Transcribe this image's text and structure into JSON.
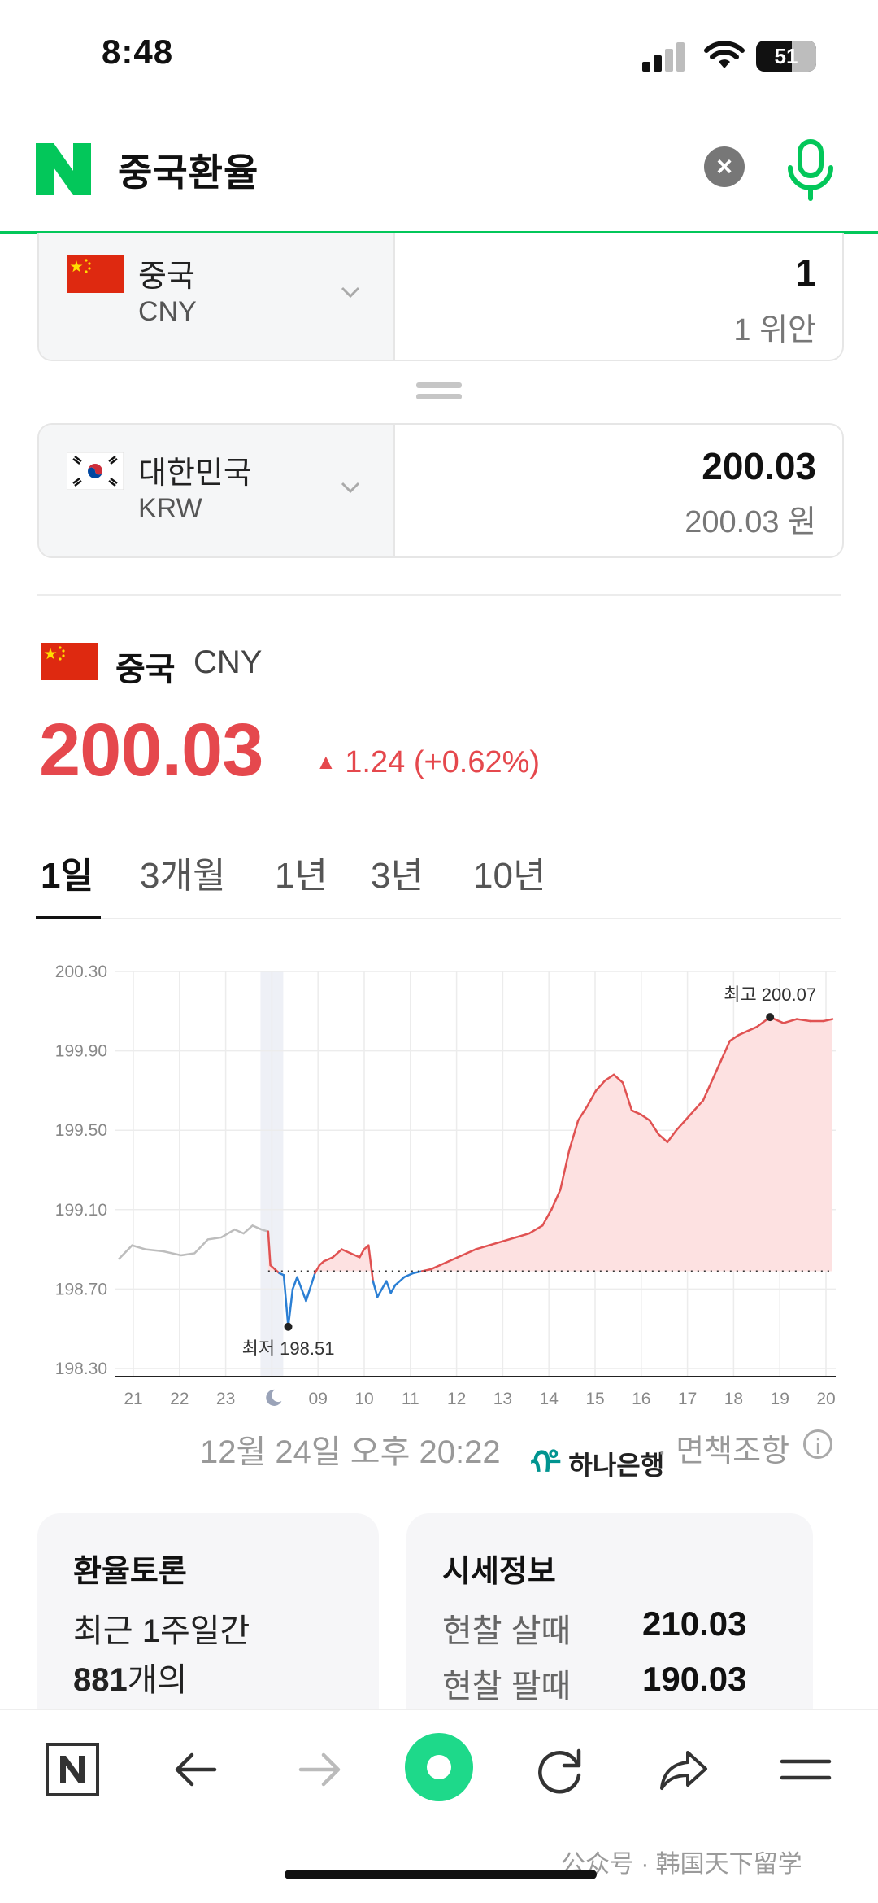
{
  "status_bar": {
    "time": "8:48",
    "battery": "51"
  },
  "search": {
    "query": "중국환율"
  },
  "converter": {
    "from": {
      "name": "중국",
      "code": "CNY",
      "amount": "1",
      "amount_text": "1 위안"
    },
    "to": {
      "name": "대한민국",
      "code": "KRW",
      "amount": "200.03",
      "amount_text": "200.03 원"
    }
  },
  "rate": {
    "country": "중국",
    "code": "CNY",
    "value": "200.03",
    "change": "1.24 (+0.62%)",
    "direction": "up",
    "color": "#e5484d"
  },
  "tabs": [
    {
      "label": "1일",
      "active": true
    },
    {
      "label": "3개월",
      "active": false
    },
    {
      "label": "1년",
      "active": false
    },
    {
      "label": "3년",
      "active": false
    },
    {
      "label": "10년",
      "active": false
    }
  ],
  "chart_data": {
    "type": "line",
    "y_ticks": [
      "200.30",
      "199.90",
      "199.50",
      "199.10",
      "198.70",
      "198.30"
    ],
    "ylim": [
      198.3,
      200.3
    ],
    "x_ticks": [
      "21",
      "22",
      "23",
      "moon-icon",
      "09",
      "10",
      "11",
      "12",
      "13",
      "14",
      "15",
      "16",
      "17",
      "18",
      "19",
      "20"
    ],
    "baseline": 198.79,
    "max_label": "최고 200.07",
    "min_label": "최저 198.51",
    "colors": {
      "up": "#e05252",
      "down": "#2b7fd4",
      "prior": "#bdbdbd",
      "fill": "#fde1e1"
    },
    "series": [
      {
        "name": "",
        "x": [
          0,
          0.3,
          0.6,
          1.0,
          1.4,
          1.7,
          2.0,
          2.3,
          2.6,
          2.8,
          3.0,
          3.2,
          3.35,
          3.4,
          3.5,
          3.6,
          3.7,
          3.8,
          3.9,
          4.0,
          4.2,
          4.4,
          4.5,
          4.6,
          4.8,
          5.0,
          5.2,
          5.4,
          5.5,
          5.6,
          5.7,
          5.8,
          5.9,
          6.0,
          6.1,
          6.2,
          6.4,
          6.6,
          6.8,
          7.0,
          7.2,
          7.4,
          7.6,
          7.8,
          8.0,
          8.3,
          8.6,
          8.9,
          9.2,
          9.5,
          9.7,
          9.9,
          10.1,
          10.3,
          10.5,
          10.7,
          10.9,
          11.1,
          11.3,
          11.5,
          11.7,
          11.9,
          12.1,
          12.3,
          12.5,
          12.7,
          12.9,
          13.1,
          13.3,
          13.5,
          13.7,
          13.9,
          14.1,
          14.3,
          14.6,
          14.9,
          15.2,
          15.5,
          15.8,
          16.0
        ],
        "y": [
          198.85,
          198.92,
          198.9,
          198.89,
          198.87,
          198.88,
          198.95,
          198.96,
          199.0,
          198.98,
          199.02,
          199.0,
          198.99,
          198.82,
          198.8,
          198.78,
          198.77,
          198.51,
          198.7,
          198.76,
          198.64,
          198.78,
          198.82,
          198.84,
          198.86,
          198.9,
          198.88,
          198.86,
          198.9,
          198.92,
          198.74,
          198.66,
          198.7,
          198.74,
          198.68,
          198.72,
          198.76,
          198.78,
          198.79,
          198.8,
          198.82,
          198.84,
          198.86,
          198.88,
          198.9,
          198.92,
          198.94,
          198.96,
          198.98,
          199.02,
          199.1,
          199.2,
          199.4,
          199.55,
          199.62,
          199.7,
          199.75,
          199.78,
          199.74,
          199.6,
          199.58,
          199.55,
          199.48,
          199.44,
          199.5,
          199.55,
          199.6,
          199.65,
          199.75,
          199.85,
          199.95,
          199.98,
          200.0,
          200.02,
          200.07,
          200.04,
          200.06,
          200.05,
          200.05,
          200.06
        ]
      }
    ]
  },
  "updated": "12월 24일 오후 20:22",
  "provider": "하나은행",
  "disclaimer": "· 면책조항",
  "forum_card": {
    "title": "환율토론",
    "line1": "최근 1주일간",
    "count": "881",
    "count_suffix": "개의"
  },
  "quote_card": {
    "title": "시세정보",
    "rows": [
      {
        "label": "현찰 살때",
        "value": "210.03"
      },
      {
        "label": "현찰 팔때",
        "value": "190.03"
      }
    ]
  },
  "watermark": "公众号 · 韩国天下留学"
}
